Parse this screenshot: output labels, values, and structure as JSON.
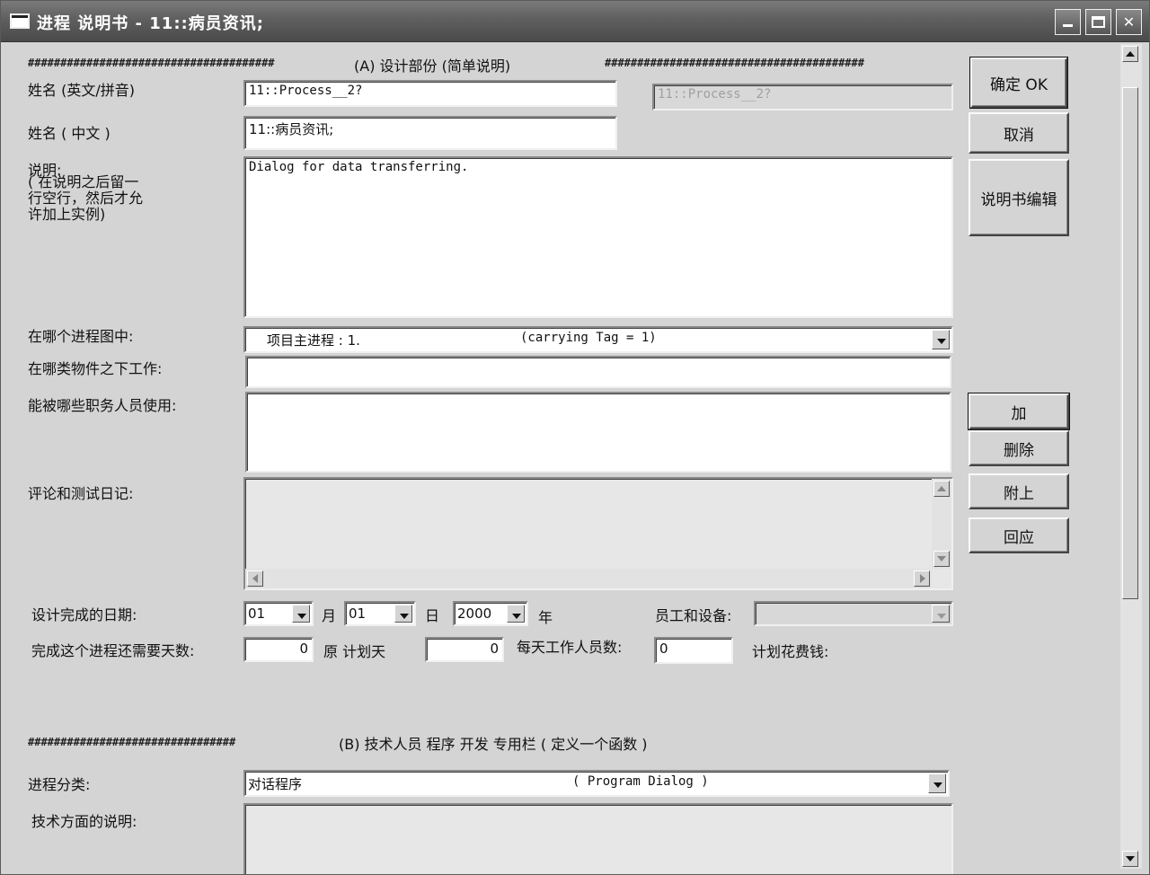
{
  "window": {
    "title": "进程 说明书 - 11::病员资讯;"
  },
  "section_a": {
    "hashes_left": "######################################",
    "hashes_right": "########################################",
    "header": "(A)    设计部份  (简单说明)"
  },
  "form": {
    "name_en_label": "姓名 (英文/拼音)",
    "name_en_value": "11::Process__2?",
    "name_en_readonly": "11::Process__2?",
    "name_cn_label": "姓名 ( 中文 )",
    "name_cn_value": "11::病员资讯;",
    "desc_label": "说明:",
    "desc_note": "( 在说明之后留一行空行，然后才允许加上实例)",
    "desc_value": "Dialog for data transferring.",
    "process_diagram_label": "在哪个进程图中:",
    "process_diagram_value": "项目主进程 : 1.",
    "process_diagram_tag": "(carrying Tag = 1)",
    "object_class_label": "在哪类物件之下工作:",
    "object_class_value": "",
    "roles_label": "能被哪些职务人员使用:",
    "comments_label": "评论和测试日记:",
    "date_label": "设计完成的日期:",
    "month_value": "01",
    "month_unit": "月",
    "day_value": "01",
    "day_unit": "日",
    "year_value": "2000",
    "year_unit": "年",
    "staff_equipment_label": "员工和设备:",
    "days_needed_label": "完成这个进程还需要天数:",
    "days_needed_value": "0",
    "planned_days_label": "原 计划天",
    "planned_days_value": "0",
    "daily_workers_label": "每天工作人员数:",
    "daily_workers_value": "0",
    "planned_cost_label": "计划花费钱:"
  },
  "section_b": {
    "hashes": "################################",
    "header": "(B) 技术人员  程序 开发  专用栏  ( 定义一个函数 )",
    "category_label": "进程分类:",
    "category_value": "对话程序",
    "category_en": "( Program Dialog )",
    "tech_desc_label": "技术方面的说明:"
  },
  "buttons": {
    "ok": "确定 OK",
    "cancel": "取消",
    "edit_spec": "说明书编辑",
    "add": "加",
    "delete": "删除",
    "attach": "附上",
    "reply": "回应"
  }
}
